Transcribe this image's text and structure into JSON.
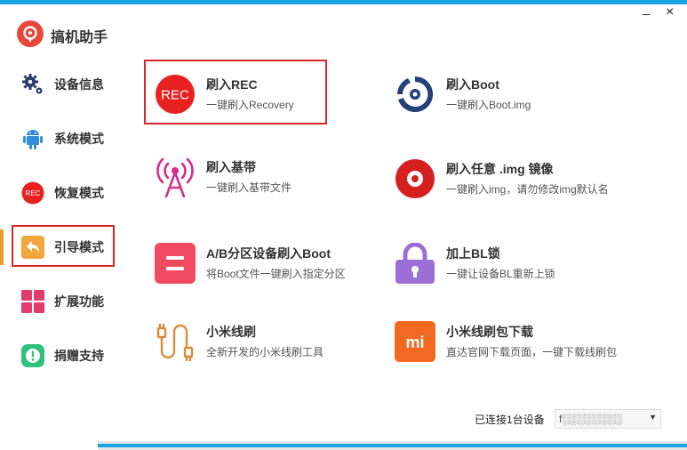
{
  "window": {
    "title": "搞机助手",
    "minimize": "_",
    "close": "×"
  },
  "sidebar": {
    "items": [
      {
        "label": "设备信息",
        "icon": "gear-icon"
      },
      {
        "label": "系统模式",
        "icon": "android-icon"
      },
      {
        "label": "恢复模式",
        "icon": "rec-icon",
        "icon_text": "REC"
      },
      {
        "label": "引导模式",
        "icon": "back-arrow-icon"
      },
      {
        "label": "扩展功能",
        "icon": "grid-icon"
      },
      {
        "label": "捐赠支持",
        "icon": "exclamation-icon"
      }
    ],
    "active_index": 3
  },
  "cards": [
    {
      "title": "刷入REC",
      "desc": "一键刷入Recovery",
      "icon": "rec-icon",
      "icon_text": "REC"
    },
    {
      "title": "刷入Boot",
      "desc": "一键刷入Boot.img",
      "icon": "boot-icon"
    },
    {
      "title": "刷入基带",
      "desc": "一键刷入基带文件",
      "icon": "antenna-icon"
    },
    {
      "title": "刷入任意 .img 镜像",
      "desc": "一键刷入img，请勿修改img默认名",
      "icon": "disc-icon"
    },
    {
      "title": "A/B分区设备刷入Boot",
      "desc": "将Boot文件一键刷入指定分区",
      "icon": "ab-partition-icon"
    },
    {
      "title": "加上BL锁",
      "desc": "一键让设备BL重新上锁",
      "icon": "lock-icon"
    },
    {
      "title": "小米线刷",
      "desc": "全新开发的小米线刷工具",
      "icon": "cable-icon"
    },
    {
      "title": "小米线刷包下载",
      "desc": "直达官网下载页面，一键下载线刷包",
      "icon": "mi-icon",
      "icon_text": "mi"
    }
  ],
  "status": {
    "connected_text": "已连接1台设备",
    "device_value": "f░░░░░░░░",
    "progress": 1.0
  },
  "colors": {
    "accent": "#1aa3e0",
    "rec_red": "#e8201f",
    "boot_navy": "#23407a",
    "antenna_magenta": "#d62d87",
    "ab_pink": "#ef4a5f",
    "lock_purple": "#9c6fd6",
    "cable_orange": "#d98a3a",
    "mi_orange": "#f26a22",
    "highlight_border": "#d9262c"
  }
}
